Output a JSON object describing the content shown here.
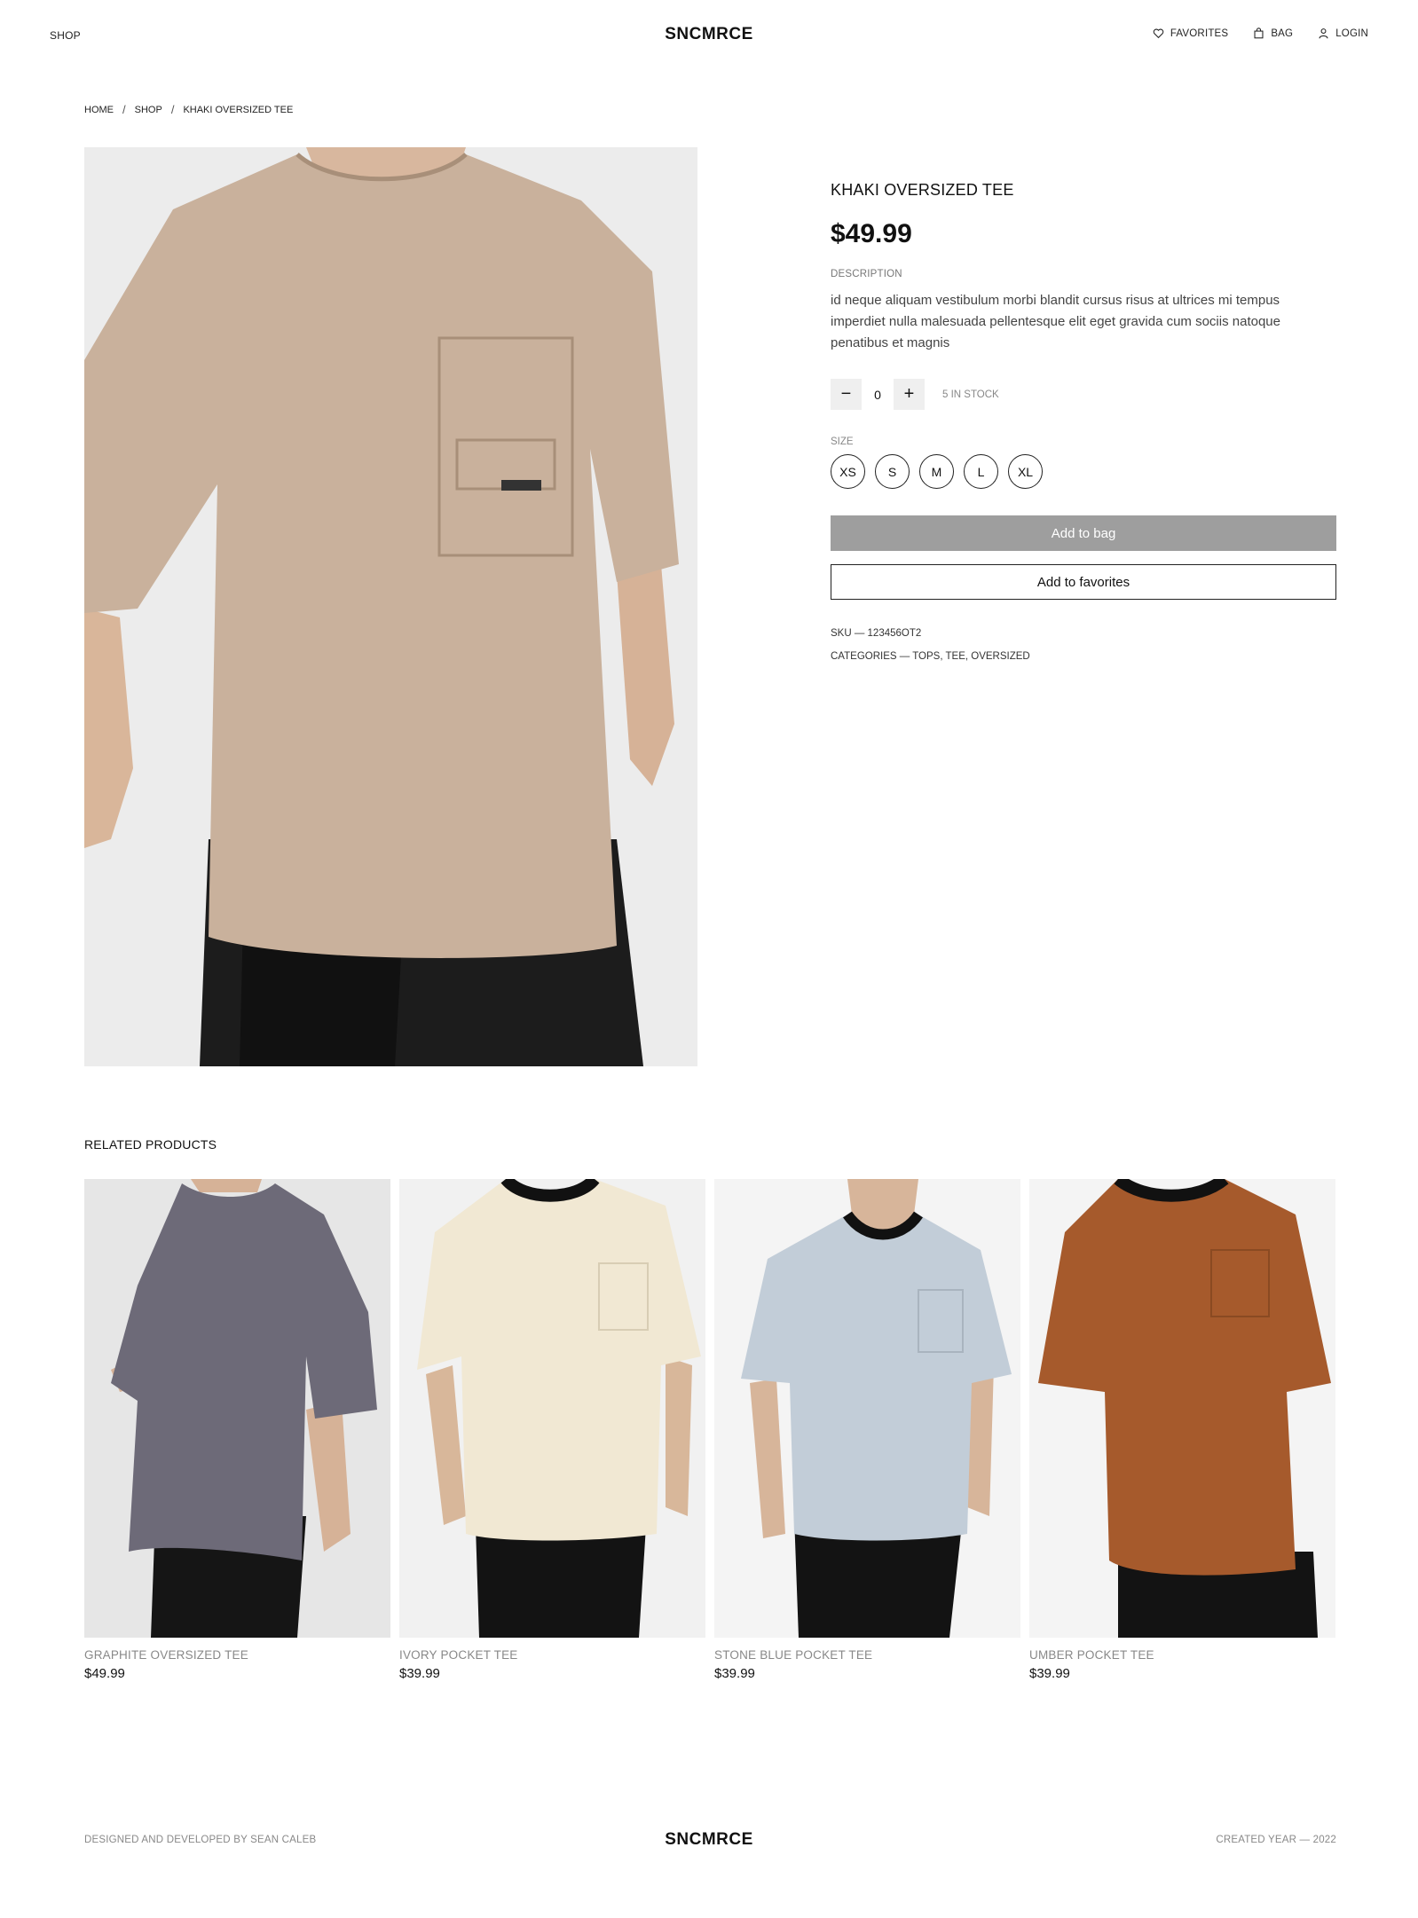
{
  "header": {
    "shop_label": "SHOP",
    "logo": "SNCMRCE",
    "favorites_label": "FAVORITES",
    "bag_label": "BAG",
    "login_label": "LOGIN"
  },
  "breadcrumb": {
    "items": [
      "HOME",
      "SHOP",
      "KHAKI OVERSIZED TEE"
    ],
    "separator": "/"
  },
  "product": {
    "title": "KHAKI OVERSIZED TEE",
    "price": "$49.99",
    "description_label": "DESCRIPTION",
    "description": "id neque aliquam vestibulum morbi blandit cursus risus at ultrices mi tempus imperdiet nulla malesuada pellentesque elit eget gravida cum sociis natoque penatibus et magnis",
    "quantity": "0",
    "minus_symbol": "−",
    "plus_symbol": "+",
    "stock": "5 IN STOCK",
    "size_label": "SIZE",
    "sizes": [
      "XS",
      "S",
      "M",
      "L",
      "XL"
    ],
    "add_to_bag": "Add to bag",
    "add_to_favorites": "Add to favorites",
    "sku": "SKU — 123456OT2",
    "categories": "CATEGORIES — TOPS, TEE, OVERSIZED",
    "shirt_color": "#c9b19c"
  },
  "related": {
    "title": "RELATED PRODUCTS",
    "items": [
      {
        "name": "GRAPHITE OVERSIZED TEE",
        "price": "$49.99",
        "color": "#6d6a78"
      },
      {
        "name": "IVORY POCKET TEE",
        "price": "$39.99",
        "color": "#f1e8d3"
      },
      {
        "name": "STONE BLUE POCKET TEE",
        "price": "$39.99",
        "color": "#c2cdd8"
      },
      {
        "name": "UMBER POCKET TEE",
        "price": "$39.99",
        "color": "#a65a2c"
      }
    ]
  },
  "footer": {
    "credit": "DESIGNED AND DEVELOPED BY SEAN CALEB",
    "logo": "SNCMRCE",
    "year": "CREATED YEAR — 2022"
  },
  "colors": {
    "primary_button_bg": "#9e9e9e",
    "text": "#111111",
    "muted": "#888888"
  }
}
